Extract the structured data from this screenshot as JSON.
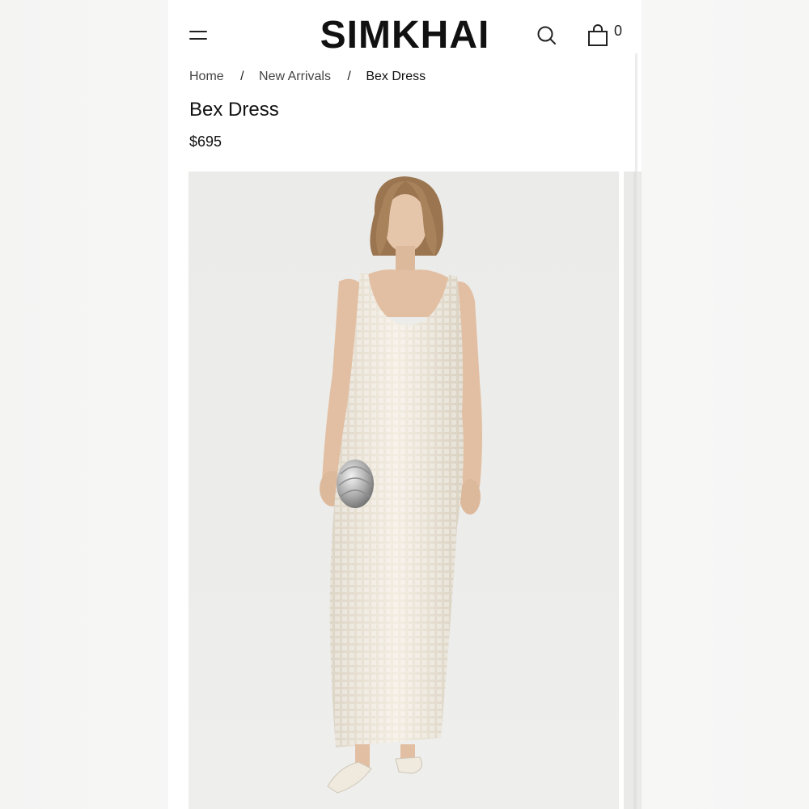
{
  "header": {
    "logo": "SIMKHAI",
    "cart_count": "0",
    "icons": [
      "menu-icon",
      "search-icon",
      "bag-icon"
    ]
  },
  "breadcrumb": [
    {
      "label": "Home"
    },
    {
      "label": "New Arrivals"
    },
    {
      "label": "Bex Dress"
    }
  ],
  "breadcrumb_separator": "/",
  "product": {
    "title": "Bex Dress",
    "price": "$695"
  },
  "colors": {
    "background": "#ffffff",
    "text": "#111111",
    "image_backdrop": "#ebebe9",
    "dress": "#ede6d8",
    "hair": "#a07a55",
    "skin": "#e4c2a6",
    "clutch": "#bdbdbd"
  }
}
